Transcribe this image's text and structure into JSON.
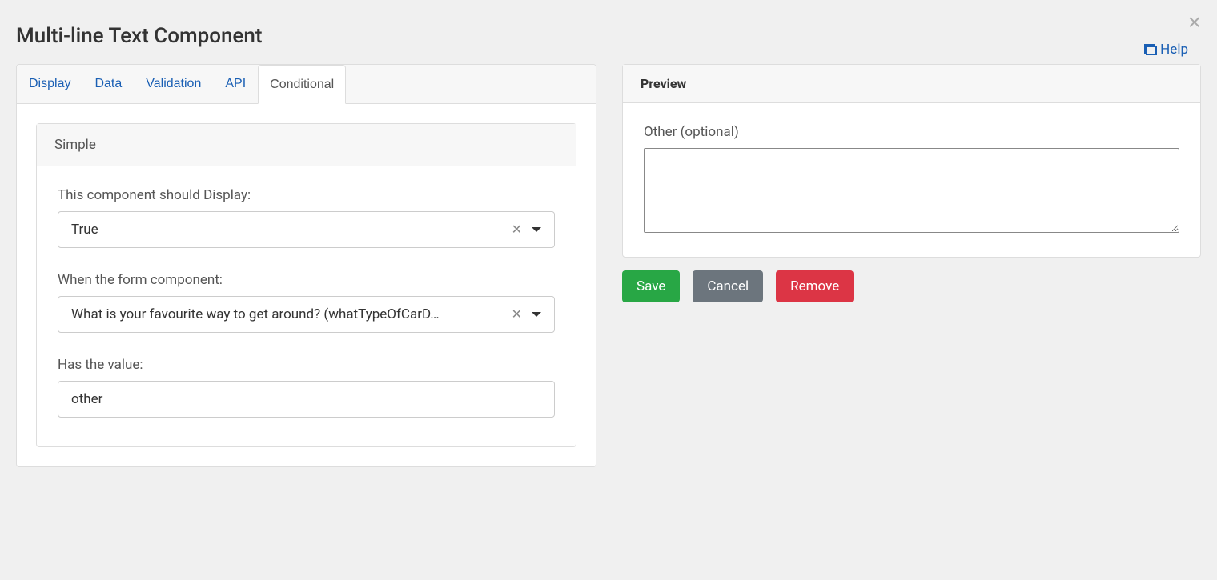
{
  "header": {
    "title": "Multi-line Text Component",
    "help_label": "Help"
  },
  "tabs": {
    "display": "Display",
    "data": "Data",
    "validation": "Validation",
    "api": "API",
    "conditional": "Conditional"
  },
  "conditional": {
    "card_title": "Simple",
    "display_label": "This component should Display:",
    "display_value": "True",
    "when_label": "When the form component:",
    "when_value": "What is your favourite way to get around? (whatTypeOfCarD…",
    "value_label": "Has the value:",
    "value_value": "other"
  },
  "preview": {
    "title": "Preview",
    "field_label": "Other (optional)",
    "field_value": ""
  },
  "buttons": {
    "save": "Save",
    "cancel": "Cancel",
    "remove": "Remove"
  }
}
